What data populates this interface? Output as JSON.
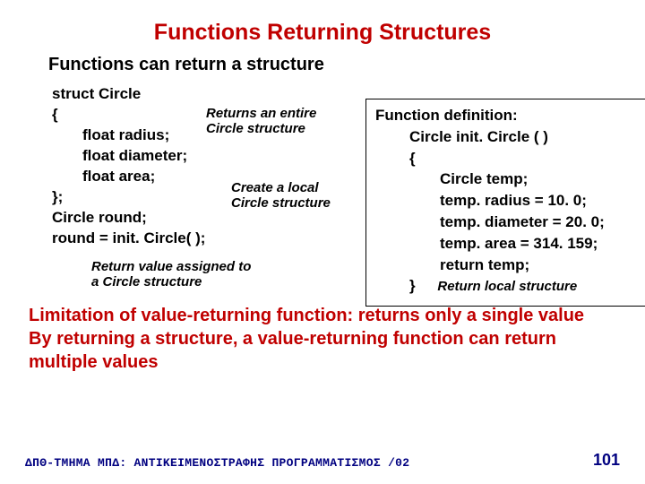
{
  "title": "Functions Returning Structures",
  "subtitle": "Functions can return a structure",
  "struct_code": {
    "l1": "struct Circle",
    "l2": "{",
    "l3": "float radius;",
    "l4": "float diameter;",
    "l5": "float area;",
    "l6": "};",
    "l7": "Circle round;",
    "l8": "round = init. Circle( );"
  },
  "annotations": {
    "returns_entire_l1": "Returns an entire",
    "returns_entire_l2": "Circle structure",
    "create_local_l1": "Create a local",
    "create_local_l2": "Circle structure",
    "return_assigned_l1": "Return value assigned to",
    "return_assigned_l2": "a Circle structure",
    "return_local": "Return local structure"
  },
  "definition": {
    "header": "Function definition:",
    "l1": "Circle init. Circle (  )",
    "l2": "{",
    "l3": "Circle temp;",
    "l4": "temp. radius = 10. 0;",
    "l5": "temp. diameter = 20. 0;",
    "l6": "temp. area = 314. 159;",
    "l7": "return temp;",
    "l8": "}"
  },
  "limitation": {
    "l1": "Limitation of value-returning function: returns only a single value",
    "l2": "By returning a structure, a value-returning function can return multiple values"
  },
  "footer": {
    "left": "ΔΠΘ-ΤΜΗΜΑ ΜΠΔ: ΑΝΤΙΚΕΙΜΕΝΟΣΤΡΑΦΗΣ ΠΡΟΓΡΑΜΜΑΤΙΣΜΟΣ /02",
    "page": "101"
  }
}
